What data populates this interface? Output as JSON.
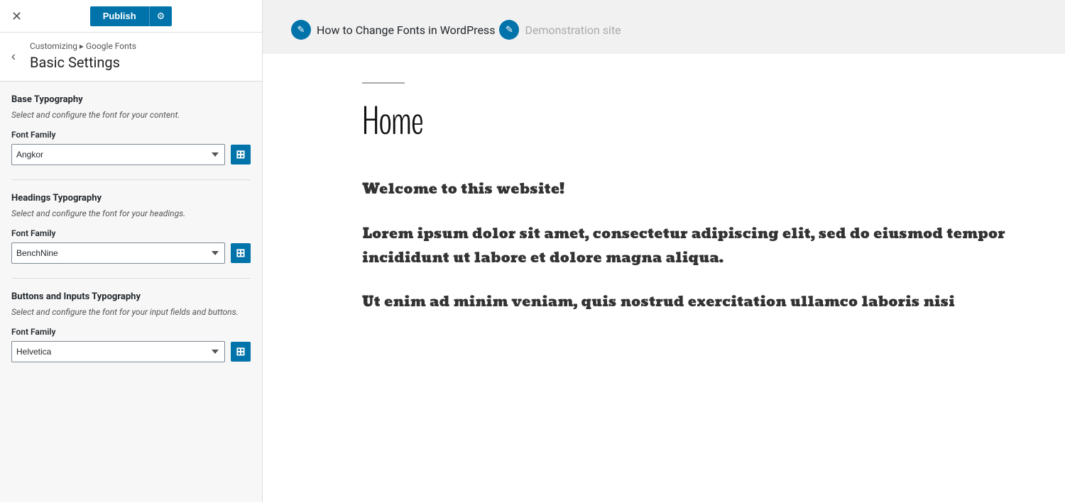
{
  "topbar": {
    "close_label": "✕",
    "publish_label": "Publish",
    "gear_label": "⚙"
  },
  "breadcrumb": {
    "back_label": "‹",
    "path": "Customizing ▸ Google Fonts",
    "title": "Basic Settings"
  },
  "sections": [
    {
      "id": "base-typography",
      "heading": "Base Typography",
      "desc": "Select and configure the font for your content.",
      "font_family_label": "Font Family",
      "font_value": "Angkor"
    },
    {
      "id": "headings-typography",
      "heading": "Headings Typography",
      "desc": "Select and configure the font for your headings.",
      "font_family_label": "Font Family",
      "font_value": "BenchNine"
    },
    {
      "id": "buttons-inputs-typography",
      "heading": "Buttons and Inputs Typography",
      "desc": "Select and configure the font for your input fields and buttons.",
      "font_family_label": "Font Family",
      "font_value": "Helvetica"
    }
  ],
  "preview": {
    "link1_label": "How to Change Fonts in WordPress",
    "link2_label": "Demonstration site",
    "rule": "",
    "home_title": "Home",
    "welcome": "Welcome to this website!",
    "lorem1": "Lorem ipsum dolor sit amet, consectetur adipiscing elit, sed do eiusmod tempor incididunt ut labore et dolore magna aliqua.",
    "lorem2": "Ut enim ad minim veniam, quis nostrud exercitation ullamco laboris nisi"
  },
  "icons": {
    "edit": "✎",
    "expand": "⊞"
  }
}
